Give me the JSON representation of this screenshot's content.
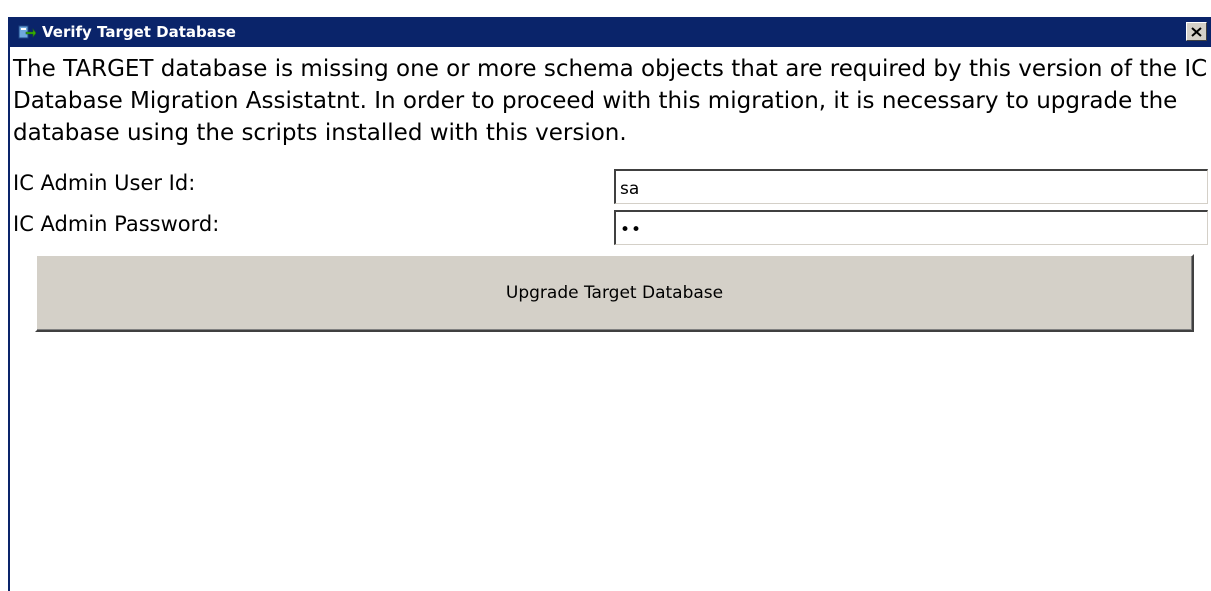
{
  "window": {
    "title": "Verify Target Database",
    "close_label": "✕"
  },
  "message": "The TARGET database is missing one or more schema objects that are required by this version of the IC Database Migration Assistatnt.  In order to proceed with this migration, it is necessary to upgrade the database using the scripts installed with this version.",
  "form": {
    "user_label": "IC Admin User Id:",
    "user_value": "sa",
    "password_label": "IC Admin Password:",
    "password_value": "••"
  },
  "actions": {
    "upgrade_label": "Upgrade Target Database"
  },
  "colors": {
    "titlebar": "#0a246a",
    "button_face": "#d4d0c8"
  }
}
